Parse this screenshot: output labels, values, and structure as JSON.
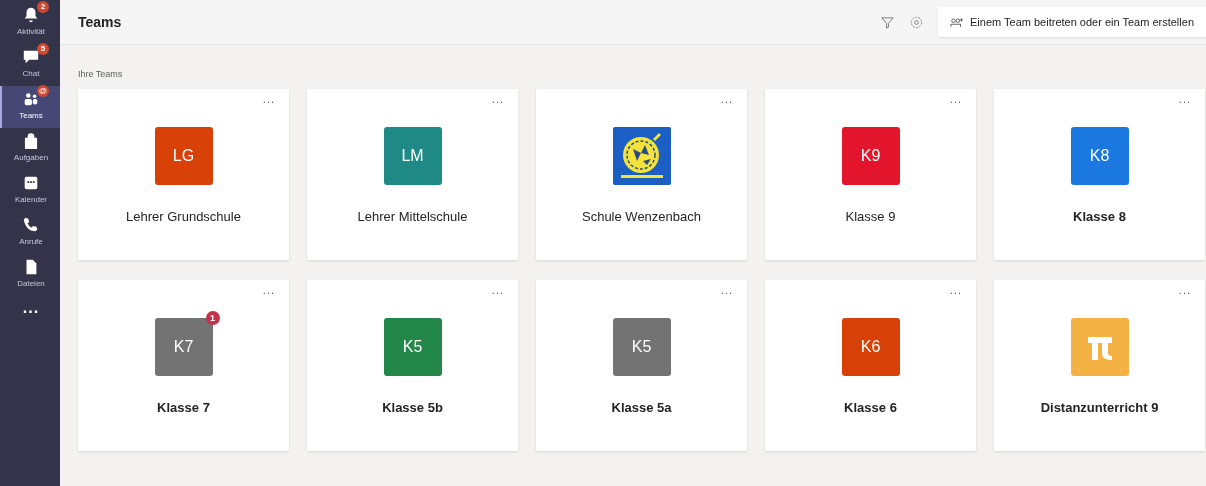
{
  "nav": [
    {
      "label": "Aktivität",
      "kind": "bell",
      "badge": "2",
      "selected": false
    },
    {
      "label": "Chat",
      "kind": "chat",
      "badge": "5",
      "selected": false
    },
    {
      "label": "Teams",
      "kind": "teams",
      "badge": "@",
      "selected": true
    },
    {
      "label": "Aufgaben",
      "kind": "bag",
      "selected": false
    },
    {
      "label": "Kalender",
      "kind": "calendar",
      "selected": false
    },
    {
      "label": "Anrufe",
      "kind": "phone",
      "selected": false
    },
    {
      "label": "Dateien",
      "kind": "file",
      "selected": false
    }
  ],
  "nav_more": "...",
  "header": {
    "title": "Teams",
    "join_button": "Einem Team beitreten oder ein Team erstellen"
  },
  "section_label": "Ihre Teams",
  "teams": [
    {
      "name": "Lehrer Grundschule",
      "avatar": {
        "kind": "initials",
        "text": "LG",
        "color": "#d74108"
      },
      "unread": false,
      "more": "..."
    },
    {
      "name": "Lehrer Mittelschule",
      "avatar": {
        "kind": "initials",
        "text": "LM",
        "color": "#1f8a85"
      },
      "unread": false,
      "more": "..."
    },
    {
      "name": "Schule Wenzenbach",
      "unread": false,
      "more": "..."
    },
    {
      "name": "Klasse 9",
      "avatar": {
        "kind": "initials",
        "text": "K9",
        "color": "#e3152d"
      },
      "unread": false,
      "more": "..."
    },
    {
      "name": "Klasse 8",
      "avatar": {
        "kind": "initials",
        "text": "K8",
        "color": "#1a78e0"
      },
      "unread": true,
      "more": "..."
    },
    {
      "name": "Klasse 7",
      "avatar": {
        "kind": "initials",
        "text": "K7",
        "color": "#737373"
      },
      "unread": true,
      "badge": "1",
      "more": "..."
    },
    {
      "name": "Klasse 5b",
      "avatar": {
        "kind": "initials",
        "text": "K5",
        "color": "#23874a"
      },
      "unread": true,
      "more": "..."
    },
    {
      "name": "Klasse 5a",
      "avatar": {
        "kind": "initials",
        "text": "K5",
        "color": "#737373"
      },
      "unread": true,
      "more": "..."
    },
    {
      "name": "Klasse 6",
      "avatar": {
        "kind": "initials",
        "text": "K6",
        "color": "#d74108"
      },
      "unread": true,
      "more": "..."
    },
    {
      "name": "Distanzunterricht 9",
      "avatar": {
        "kind": "icon",
        "color": "#f5b244"
      },
      "unread": true,
      "more": "..."
    }
  ]
}
